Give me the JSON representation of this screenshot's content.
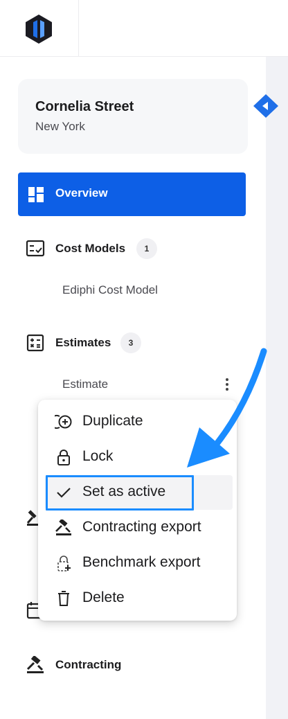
{
  "project": {
    "name": "Cornelia Street",
    "city": "New York"
  },
  "nav": {
    "overview": "Overview",
    "cost_models": {
      "label": "Cost Models",
      "count": "1",
      "items": [
        "Ediphi Cost Model"
      ]
    },
    "estimates": {
      "label": "Estimates",
      "count": "3",
      "items": [
        "Estimate"
      ]
    },
    "contracting": "Contracting"
  },
  "menu": {
    "items": [
      {
        "label": "Duplicate",
        "icon": "duplicate-icon"
      },
      {
        "label": "Lock",
        "icon": "lock-icon"
      },
      {
        "label": "Set as active",
        "icon": "check-icon"
      },
      {
        "label": "Contracting export",
        "icon": "gavel-icon"
      },
      {
        "label": "Benchmark export",
        "icon": "lock-plus-icon"
      },
      {
        "label": "Delete",
        "icon": "trash-icon"
      }
    ]
  },
  "colors": {
    "primary": "#0d5fe6",
    "focus": "#1a8cff",
    "logo": "#1b1b22"
  }
}
